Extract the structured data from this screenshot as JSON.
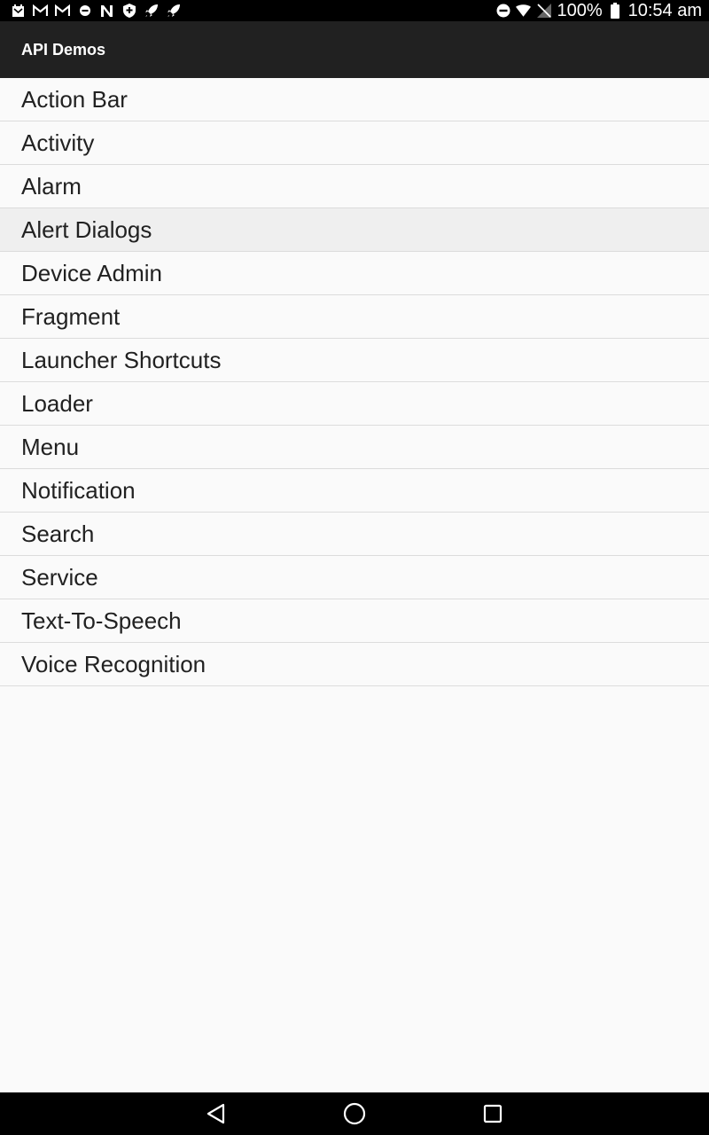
{
  "status_bar": {
    "notification_icons": [
      "gmail-calendar-icon",
      "gmail-icon",
      "gmail-icon",
      "dnd-small-icon",
      "n-icon",
      "shield-icon",
      "rocket-icon",
      "rocket-icon"
    ],
    "battery_percent": "100%",
    "time": "10:54 am"
  },
  "app_bar": {
    "title": "API Demos",
    "background": "#212121"
  },
  "list": {
    "items": [
      {
        "label": "Action Bar"
      },
      {
        "label": "Activity"
      },
      {
        "label": "Alarm"
      },
      {
        "label": "Alert Dialogs"
      },
      {
        "label": "Device Admin"
      },
      {
        "label": "Fragment"
      },
      {
        "label": "Launcher Shortcuts"
      },
      {
        "label": "Loader"
      },
      {
        "label": "Menu"
      },
      {
        "label": "Notification"
      },
      {
        "label": "Search"
      },
      {
        "label": "Service"
      },
      {
        "label": "Text-To-Speech"
      },
      {
        "label": "Voice Recognition"
      }
    ],
    "pressed_index": 3
  },
  "nav_bar": {
    "buttons": [
      "back-icon",
      "home-icon",
      "recents-icon"
    ]
  }
}
